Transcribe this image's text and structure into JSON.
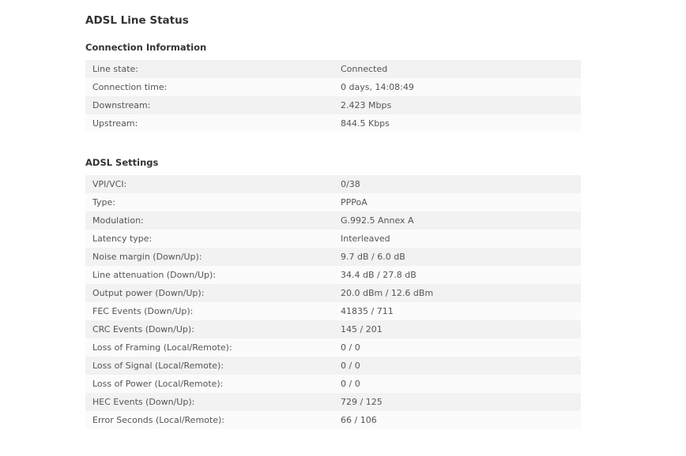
{
  "page": {
    "title": "ADSL Line Status"
  },
  "connection_info": {
    "title": "Connection Information",
    "rows": [
      {
        "label": "Line state:",
        "value": "Connected"
      },
      {
        "label": "Connection time:",
        "value": "0 days, 14:08:49"
      },
      {
        "label": "Downstream:",
        "value": "2.423 Mbps"
      },
      {
        "label": "Upstream:",
        "value": "844.5 Kbps"
      }
    ]
  },
  "adsl_settings": {
    "title": "ADSL Settings",
    "rows": [
      {
        "label": "VPI/VCI:",
        "value": "0/38"
      },
      {
        "label": "Type:",
        "value": "PPPoA"
      },
      {
        "label": "Modulation:",
        "value": "G.992.5 Annex A"
      },
      {
        "label": "Latency type:",
        "value": "Interleaved"
      },
      {
        "label": "Noise margin (Down/Up):",
        "value": "9.7 dB / 6.0 dB"
      },
      {
        "label": "Line attenuation (Down/Up):",
        "value": "34.4 dB / 27.8 dB"
      },
      {
        "label": "Output power (Down/Up):",
        "value": "20.0 dBm / 12.6 dBm"
      },
      {
        "label": "FEC Events (Down/Up):",
        "value": "41835 / 711"
      },
      {
        "label": "CRC Events (Down/Up):",
        "value": "145 / 201"
      },
      {
        "label": "Loss of Framing (Local/Remote):",
        "value": "0 / 0"
      },
      {
        "label": "Loss of Signal (Local/Remote):",
        "value": "0 / 0"
      },
      {
        "label": "Loss of Power (Local/Remote):",
        "value": "0 / 0"
      },
      {
        "label": "HEC Events (Down/Up):",
        "value": "729 / 125"
      },
      {
        "label": "Error Seconds (Local/Remote):",
        "value": "66 / 106"
      }
    ]
  }
}
